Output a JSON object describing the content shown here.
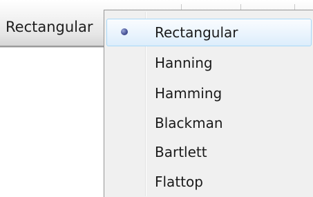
{
  "combo": {
    "current_value": "Rectangular"
  },
  "menu": {
    "items": [
      {
        "label": "Rectangular",
        "checked": true,
        "highlighted": true
      },
      {
        "label": "Hanning",
        "checked": false,
        "highlighted": false
      },
      {
        "label": "Hamming",
        "checked": false,
        "highlighted": false
      },
      {
        "label": "Blackman",
        "checked": false,
        "highlighted": false
      },
      {
        "label": "Bartlett",
        "checked": false,
        "highlighted": false
      },
      {
        "label": "Flattop",
        "checked": false,
        "highlighted": false
      }
    ],
    "check_icon": "radio-bullet-icon"
  }
}
